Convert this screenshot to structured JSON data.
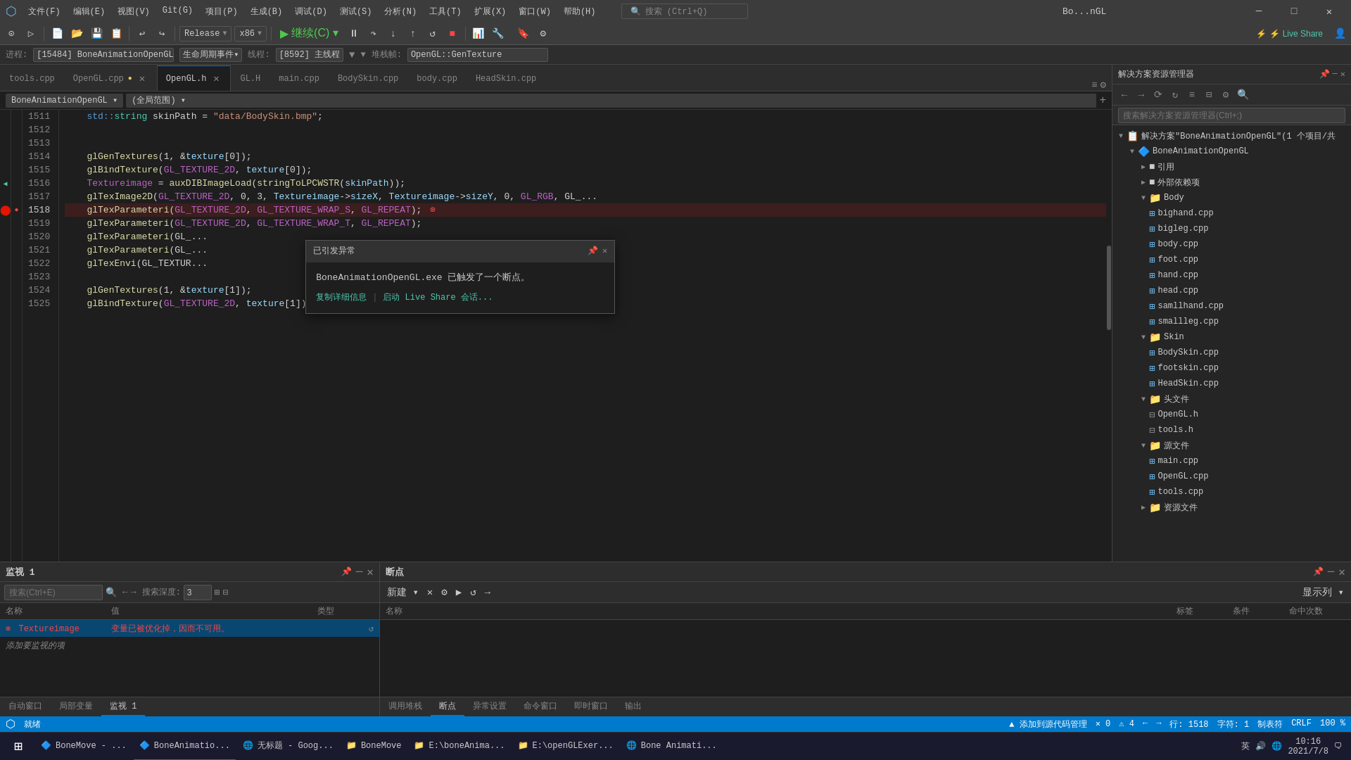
{
  "titleBar": {
    "logo": "⬡",
    "menus": [
      "文件(F)",
      "编辑(E)",
      "视图(V)",
      "Git(G)",
      "项目(P)",
      "生成(B)",
      "调试(D)",
      "测试(S)",
      "分析(N)",
      "工具(T)",
      "扩展(X)",
      "窗口(W)",
      "帮助(H)"
    ],
    "search": "搜索 (Ctrl+Q)",
    "title": "Bo...nGL",
    "minimize": "─",
    "maximize": "□",
    "close": "✕"
  },
  "toolbar": {
    "config": "Release",
    "platform": "x86",
    "run_label": "▶ 继续(C)▾",
    "live_share": "⚡ Live Share"
  },
  "debugBar": {
    "process_label": "进程:",
    "process": "[15484] BoneAnimationOpenGL ▾",
    "lifecycle_label": "生命周期事件▾",
    "thread_label": "线程:",
    "thread": "[8592] 主线程",
    "filter_icon": "▼",
    "stack_label": "堆栈帧:",
    "stack": "OpenGL::GenTexture"
  },
  "tabs": [
    {
      "label": "tools.cpp",
      "active": false,
      "modified": false
    },
    {
      "label": "OpenGL.cpp",
      "active": false,
      "modified": true
    },
    {
      "label": "OpenGL.h",
      "active": true,
      "modified": false
    },
    {
      "label": "GL.H",
      "active": false,
      "modified": false
    },
    {
      "label": "main.cpp",
      "active": false,
      "modified": false
    },
    {
      "label": "BodySkin.cpp",
      "active": false,
      "modified": false
    },
    {
      "label": "body.cpp",
      "active": false,
      "modified": false
    },
    {
      "label": "HeadSkin.cpp",
      "active": false,
      "modified": false
    }
  ],
  "breadcrumb": {
    "scope": "BoneAnimationOpenGL ▾",
    "context": "(全局范围) ▾"
  },
  "codeLines": [
    {
      "num": 1511,
      "content": "    std::string skinPath = \"data/BodySkin.bmp\";",
      "has_bookmark": false,
      "has_error": false
    },
    {
      "num": 1512,
      "content": "",
      "has_bookmark": false,
      "has_error": false
    },
    {
      "num": 1513,
      "content": "",
      "has_bookmark": false,
      "has_error": false
    },
    {
      "num": 1514,
      "content": "    glGenTextures(1, &texture[0]);",
      "has_bookmark": false,
      "has_error": false
    },
    {
      "num": 1515,
      "content": "    glBindTexture(GL_TEXTURE_2D, texture[0]);",
      "has_bookmark": false,
      "has_error": false
    },
    {
      "num": 1516,
      "content": "    Textureimage = auxDIBImageLoad(stringToLPCWSTR(skinPath));",
      "has_bookmark": true,
      "has_error": false
    },
    {
      "num": 1517,
      "content": "    glTexImage2D(GL_TEXTURE_2D, 0, 3, Textureimage->sizeX, Textureimage->sizeY, 0, GL_RGB, GL_...",
      "has_bookmark": false,
      "has_error": false
    },
    {
      "num": 1518,
      "content": "    glTexParameteri(GL_TEXTURE_2D, GL_TEXTURE_WRAP_S, GL_REPEAT);",
      "has_bookmark": false,
      "has_error": true,
      "is_current": true
    },
    {
      "num": 1519,
      "content": "    glTexParameteri(GL_TEXTURE_2D, GL_TEXTURE_WRAP_T, GL_REPEAT);",
      "has_bookmark": false,
      "has_error": false
    },
    {
      "num": 1520,
      "content": "    glTexParameteri(GL_...",
      "has_bookmark": false,
      "has_error": false
    },
    {
      "num": 1521,
      "content": "    glTexParameteri(GL_...",
      "has_bookmark": false,
      "has_error": false
    },
    {
      "num": 1522,
      "content": "    glTexEnvi(GL_TEXTUR...",
      "has_bookmark": false,
      "has_error": false
    },
    {
      "num": 1523,
      "content": "",
      "has_bookmark": false,
      "has_error": false
    },
    {
      "num": 1524,
      "content": "    glGenTextures(1, &texture[1]);",
      "has_bookmark": false,
      "has_error": false
    },
    {
      "num": 1525,
      "content": "    glBindTexture(GL_TEXTURE_2D, texture[1]);",
      "has_bookmark": false,
      "has_error": false
    }
  ],
  "exception": {
    "header": "已引发异常",
    "pin_icon": "📌",
    "close_icon": "✕",
    "message": "BoneAnimationOpenGL.exe 已触发了一个断点。",
    "copy_link": "复制详细信息",
    "separator": "|",
    "liveshare_link": "启动 Live Share 会话..."
  },
  "statusBar": {
    "errors": "✕ 0",
    "warnings": "⚠ 4",
    "nav_prev": "←",
    "nav_next": "→",
    "row_label": "行: 1518",
    "col_label": "字符: 1",
    "tab_label": "制表符",
    "encoding": "CRLF",
    "zoom": "100 %"
  },
  "watchPanel": {
    "title": "监视 1",
    "pin_icon": "📌",
    "minimize_icon": "─",
    "close_icon": "✕",
    "search_placeholder": "搜索(Ctrl+E)",
    "depth_label": "搜索深度:",
    "depth_value": "3",
    "columns": {
      "name": "名称",
      "value": "值",
      "type": "类型"
    },
    "rows": [
      {
        "name": "Textureimage",
        "value": "变量已被优化掉，因而不可用。",
        "type": "",
        "has_error": true
      }
    ],
    "add_text": "添加要监视的项",
    "tabs": [
      "自动窗口",
      "局部变量",
      "监视 1"
    ]
  },
  "breakpointsPanel": {
    "title": "断点",
    "pin_icon": "📌",
    "minimize_icon": "─",
    "close_icon": "✕",
    "toolbar_btns": [
      "新建▾",
      "✕",
      "⚙",
      "▶",
      "↺",
      "→"
    ],
    "display_btn": "显示列 ▾",
    "columns": {
      "name": "名称",
      "tag": "标签",
      "condition": "条件",
      "hit_count": "命中次数"
    },
    "tabs": [
      "调用堆栈",
      "断点",
      "异常设置",
      "命令窗口",
      "即时窗口",
      "输出"
    ]
  },
  "solutionExplorer": {
    "title": "解决方案资源管理器",
    "search_placeholder": "搜索解决方案资源管理器(Ctrl+;)",
    "solution_label": "解决方案\"BoneAnimationOpenGL\"(1 个项目/共",
    "project": "BoneAnimationOpenGL",
    "nodes": [
      {
        "label": "引用",
        "level": 2,
        "type": "folder",
        "expanded": false
      },
      {
        "label": "外部依赖项",
        "level": 2,
        "type": "folder",
        "expanded": false
      },
      {
        "label": "Body",
        "level": 2,
        "type": "folder",
        "expanded": true
      },
      {
        "label": "bighand.cpp",
        "level": 3,
        "type": "cpp"
      },
      {
        "label": "bigleg.cpp",
        "level": 3,
        "type": "cpp"
      },
      {
        "label": "body.cpp",
        "level": 3,
        "type": "cpp"
      },
      {
        "label": "foot.cpp",
        "level": 3,
        "type": "cpp"
      },
      {
        "label": "hand.cpp",
        "level": 3,
        "type": "cpp"
      },
      {
        "label": "head.cpp",
        "level": 3,
        "type": "cpp"
      },
      {
        "label": "samllhand.cpp",
        "level": 3,
        "type": "cpp"
      },
      {
        "label": "smallleg.cpp",
        "level": 3,
        "type": "cpp"
      },
      {
        "label": "Skin",
        "level": 2,
        "type": "folder",
        "expanded": true
      },
      {
        "label": "BodySkin.cpp",
        "level": 3,
        "type": "cpp"
      },
      {
        "label": "footskin.cpp",
        "level": 3,
        "type": "cpp"
      },
      {
        "label": "HeadSkin.cpp",
        "level": 3,
        "type": "cpp"
      },
      {
        "label": "头文件",
        "level": 2,
        "type": "folder",
        "expanded": true
      },
      {
        "label": "OpenGL.h",
        "level": 3,
        "type": "h"
      },
      {
        "label": "tools.h",
        "level": 3,
        "type": "h"
      },
      {
        "label": "源文件",
        "level": 2,
        "type": "folder",
        "expanded": true
      },
      {
        "label": "main.cpp",
        "level": 3,
        "type": "cpp"
      },
      {
        "label": "OpenGL.cpp",
        "level": 3,
        "type": "cpp"
      },
      {
        "label": "tools.cpp",
        "level": 3,
        "type": "cpp"
      },
      {
        "label": "资源文件",
        "level": 2,
        "type": "folder",
        "expanded": false
      }
    ]
  },
  "taskbar": {
    "start_icon": "⊞",
    "items": [
      {
        "label": "BoneMove - ...",
        "icon": "🔷",
        "active": false
      },
      {
        "label": "BoneAnimatio...",
        "icon": "🔷",
        "active": true
      },
      {
        "label": "无标题 - Goog...",
        "icon": "🌐",
        "active": false
      },
      {
        "label": "BoneMove",
        "icon": "📁",
        "active": false
      },
      {
        "label": "E:\\boneAnima...",
        "icon": "📁",
        "active": false
      },
      {
        "label": "E:\\openGLExer...",
        "icon": "📁",
        "active": false
      },
      {
        "label": "Bone Animati...",
        "icon": "🌐",
        "active": false
      }
    ],
    "tray": "英",
    "time": "10:16",
    "date": "2021/7/8",
    "status_right": "添加到源代码管理 ▲"
  }
}
